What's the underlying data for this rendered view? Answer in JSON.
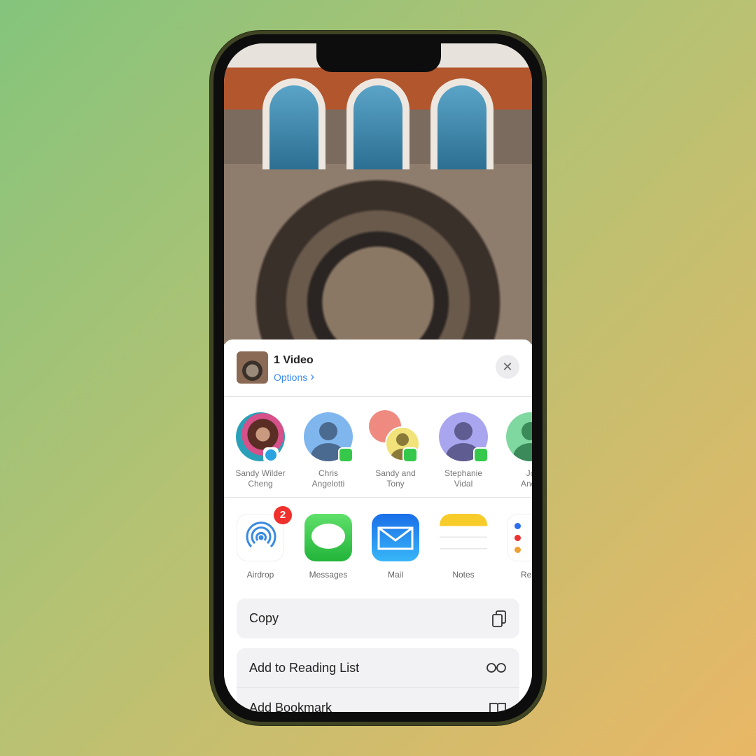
{
  "header": {
    "title": "1 Video",
    "options_label": "Options",
    "options_chevron": "›",
    "close_icon": "✕"
  },
  "contacts": [
    {
      "name_line1": "Sandy Wilder",
      "name_line2": "Cheng",
      "app": "telegram",
      "color": "#7a4a4a"
    },
    {
      "name_line1": "Chris",
      "name_line2": "Angelotti",
      "app": "messages",
      "color": "#7fb6ee"
    },
    {
      "name_line1": "Sandy and",
      "name_line2": "Tony",
      "app": "messages",
      "color": "#f1e27a"
    },
    {
      "name_line1": "Stephanie",
      "name_line2": "Vidal",
      "app": "messages",
      "color": "#a9a6ef"
    },
    {
      "name_line1": "Jo",
      "name_line2": "Ande",
      "app": "messages",
      "color": "#7fd8a0"
    }
  ],
  "apps": [
    {
      "label": "Airdrop",
      "badge": "2",
      "icon": "airdrop-icon"
    },
    {
      "label": "Messages",
      "icon": "messages-icon"
    },
    {
      "label": "Mail",
      "icon": "mail-icon"
    },
    {
      "label": "Notes",
      "icon": "notes-icon"
    },
    {
      "label": "Remi",
      "icon": "reminders-icon"
    }
  ],
  "actions": [
    {
      "label": "Copy",
      "icon": "copy-icon"
    },
    {
      "label": "Add to Reading List",
      "icon": "glasses-icon"
    },
    {
      "label": "Add Bookmark",
      "icon": "book-icon"
    }
  ],
  "colors": {
    "accent": "#3c8cf0",
    "badge": "#f0302c",
    "messages": "#35c84a",
    "mail": "#1e8cf0",
    "notes": "#f7cc2a"
  }
}
